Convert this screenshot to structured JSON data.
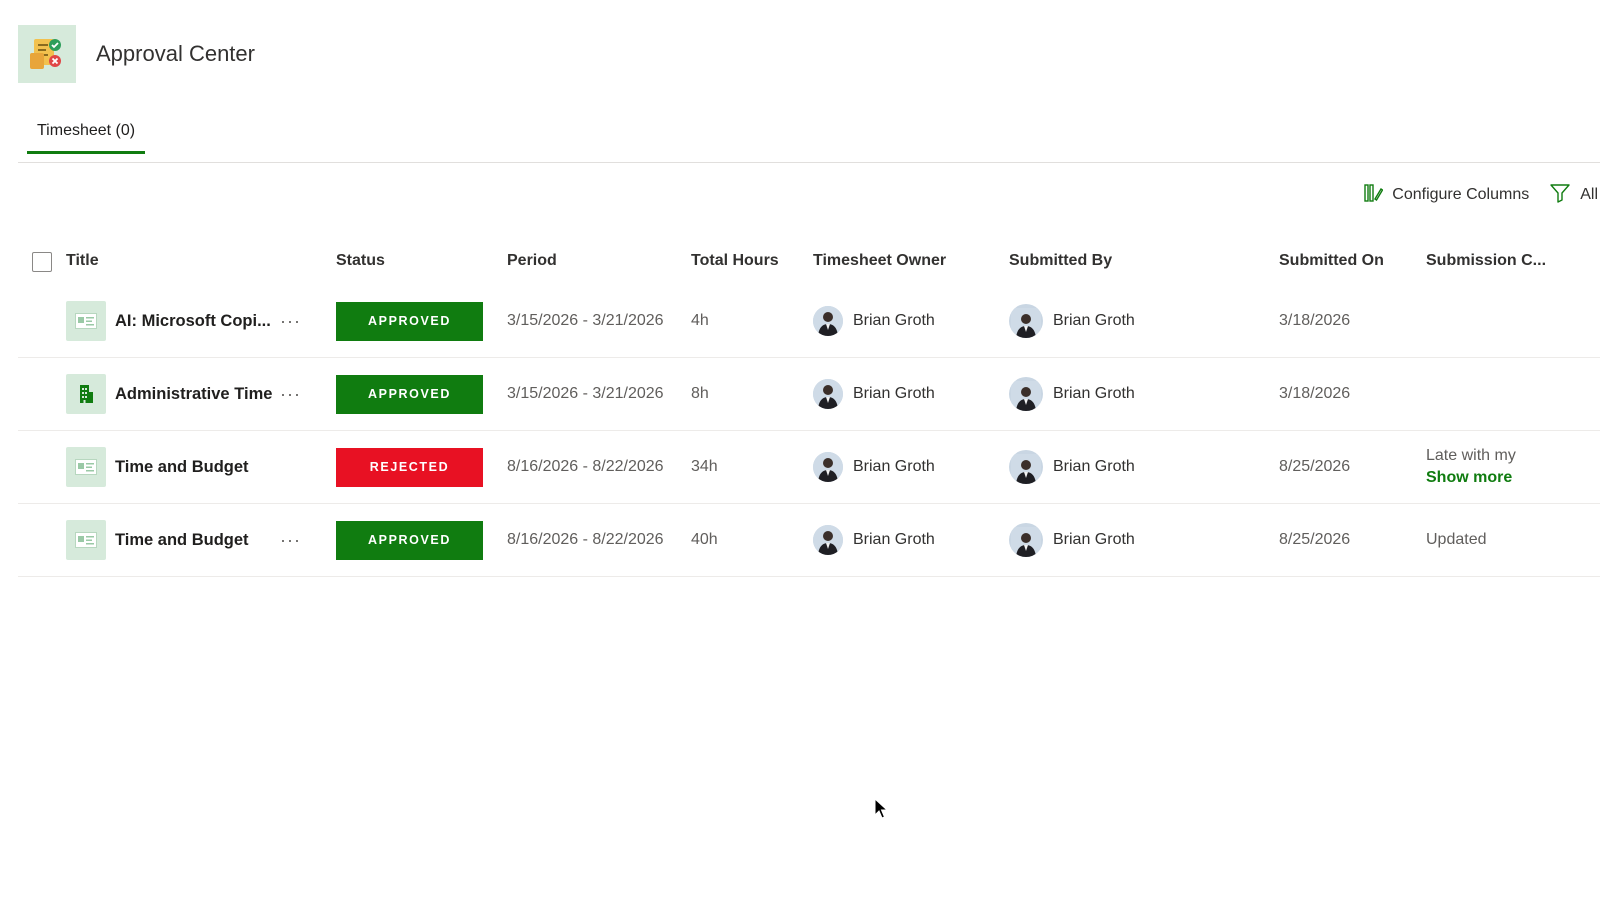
{
  "app": {
    "title": "Approval Center",
    "icon": "approval-center-icon"
  },
  "tabs": [
    {
      "label": "Timesheet (0)",
      "selected": true
    }
  ],
  "toolbar": {
    "configure_columns": {
      "label": "Configure Columns",
      "icon": "configure-columns-icon"
    },
    "filter": {
      "label": "All",
      "icon": "filter-icon"
    }
  },
  "colors": {
    "accent": "#107c10",
    "approved": "#107c10",
    "rejected": "#e81123",
    "icon_bg": "#d6eadb"
  },
  "table": {
    "columns": [
      "Title",
      "Status",
      "Period",
      "Total Hours",
      "Timesheet Owner",
      "Submitted By",
      "Submitted On",
      "Submission C..."
    ],
    "rows": [
      {
        "icon": "timesheet-doc-icon",
        "title": "AI: Microsoft Copi...",
        "has_more": true,
        "status": "APPROVED",
        "period": "3/15/2026 - 3/21/2026",
        "total_hours": "4h",
        "owner": "Brian Groth",
        "submitted_by": "Brian Groth",
        "submitted_on": "3/18/2026",
        "comment": "",
        "show_more": ""
      },
      {
        "icon": "building-icon",
        "title": "Administrative Time",
        "has_more": true,
        "status": "APPROVED",
        "period": "3/15/2026 - 3/21/2026",
        "total_hours": "8h",
        "owner": "Brian Groth",
        "submitted_by": "Brian Groth",
        "submitted_on": "3/18/2026",
        "comment": "",
        "show_more": ""
      },
      {
        "icon": "timesheet-doc-icon",
        "title": "Time and Budget",
        "has_more": false,
        "status": "REJECTED",
        "period": "8/16/2026 - 8/22/2026",
        "total_hours": "34h",
        "owner": "Brian Groth",
        "submitted_by": "Brian Groth",
        "submitted_on": "8/25/2026",
        "comment": "Late with my",
        "show_more": "Show more"
      },
      {
        "icon": "timesheet-doc-icon",
        "title": "Time and Budget",
        "has_more": true,
        "status": "APPROVED",
        "period": "8/16/2026 - 8/22/2026",
        "total_hours": "40h",
        "owner": "Brian Groth",
        "submitted_by": "Brian Groth",
        "submitted_on": "8/25/2026",
        "comment": "Updated",
        "show_more": ""
      }
    ]
  }
}
